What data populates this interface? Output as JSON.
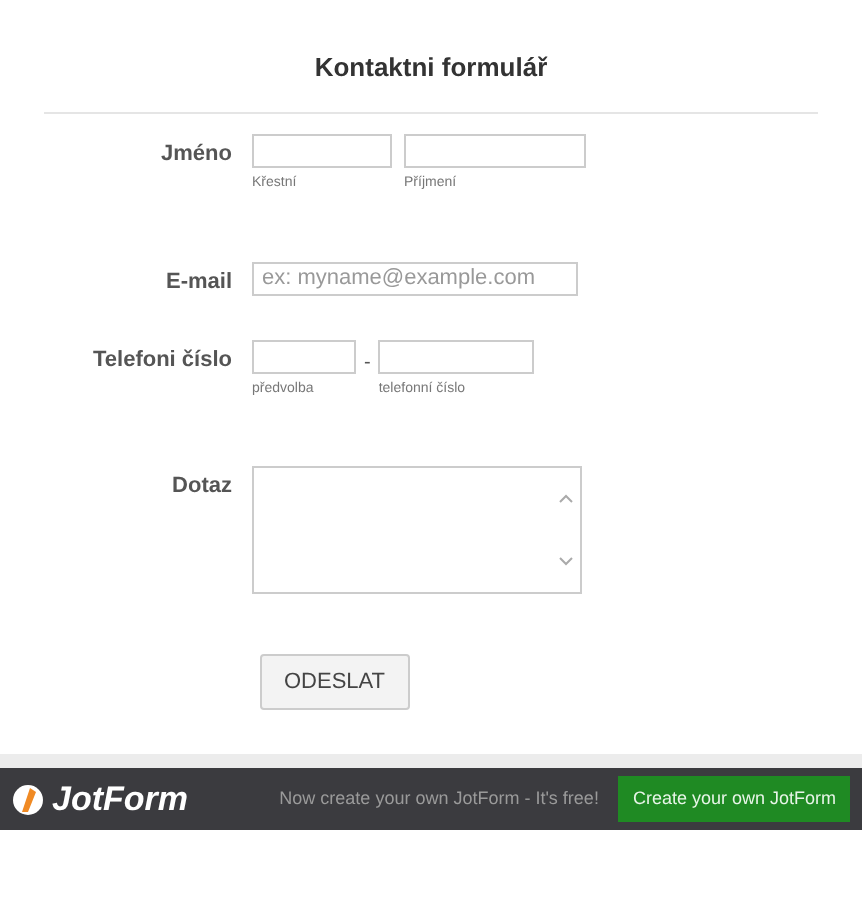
{
  "title": "Kontaktni formulář",
  "fields": [
    {
      "kind": "name",
      "label": "Jméno",
      "inputs": [
        {
          "sublabel": "Křestní"
        },
        {
          "sublabel": "Příjmení"
        }
      ]
    },
    {
      "kind": "email",
      "label": "E-mail",
      "placeholder": "ex: myname@example.com"
    },
    {
      "kind": "phone",
      "label": "Telefoni číslo",
      "separator": "-",
      "inputs": [
        {
          "sublabel": "předvolba"
        },
        {
          "sublabel": "telefonní číslo"
        }
      ]
    },
    {
      "kind": "textarea",
      "label": "Dotaz"
    }
  ],
  "submit": "ODESLAT",
  "footer": {
    "logo": "JotForm",
    "tagline": "Now create your own JotForm - It's free!",
    "button": "Create your own JotForm"
  }
}
